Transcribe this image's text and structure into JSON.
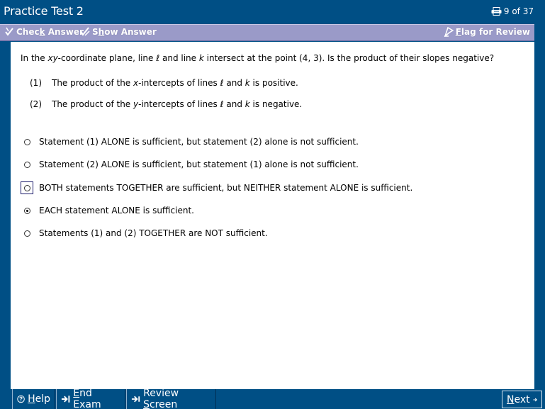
{
  "window": {
    "title": "Practice Test 2",
    "counter": "9 of 37",
    "counter_icon": "printer-icon"
  },
  "toolbar": {
    "check_answer": {
      "pre": "Chec",
      "ul": "k",
      "post": " Answer"
    },
    "show_answer": {
      "pre": "S",
      "ul": "h",
      "post": "ow Answer"
    },
    "flag_review": {
      "pre": "",
      "ul": "F",
      "post": "lag for Review"
    }
  },
  "question": {
    "stem_parts": [
      "In the ",
      "xy",
      "-coordinate plane, line ℓ and line ",
      "k",
      " intersect at the point (4, 3).  Is the product of their slopes negative?"
    ],
    "statements": [
      {
        "num": "(1)",
        "parts": [
          "The product of the ",
          "x",
          "-intercepts of lines ℓ and ",
          "k",
          " is positive."
        ]
      },
      {
        "num": "(2)",
        "parts": [
          "The product of the ",
          "y",
          "-intercepts of lines ℓ and ",
          "k",
          " is negative."
        ]
      }
    ]
  },
  "options": [
    {
      "label": "Statement (1) ALONE is sufficient, but statement (2) alone is not sufficient.",
      "checked": false,
      "focused": false
    },
    {
      "label": "Statement (2) ALONE is sufficient, but statement (1) alone is not sufficient.",
      "checked": false,
      "focused": false
    },
    {
      "label": "BOTH statements TOGETHER are sufficient, but NEITHER statement ALONE is sufficient.",
      "checked": false,
      "focused": true
    },
    {
      "label": "EACH statement ALONE is sufficient.",
      "checked": true,
      "focused": false
    },
    {
      "label": "Statements (1) and (2) TOGETHER are NOT sufficient.",
      "checked": false,
      "focused": false
    }
  ],
  "bottom": {
    "help": {
      "pre": "",
      "ul": "H",
      "post": "elp"
    },
    "end_exam": {
      "pre": "",
      "ul": "E",
      "post": "nd Exam"
    },
    "review": {
      "pre": "Review ",
      "ul": "S",
      "post": "creen"
    },
    "next": {
      "pre": "",
      "ul": "N",
      "post": "ext"
    }
  },
  "colors": {
    "frame": "#004f85",
    "toolbar": "#9a9ac8",
    "content": "#ffffff"
  }
}
